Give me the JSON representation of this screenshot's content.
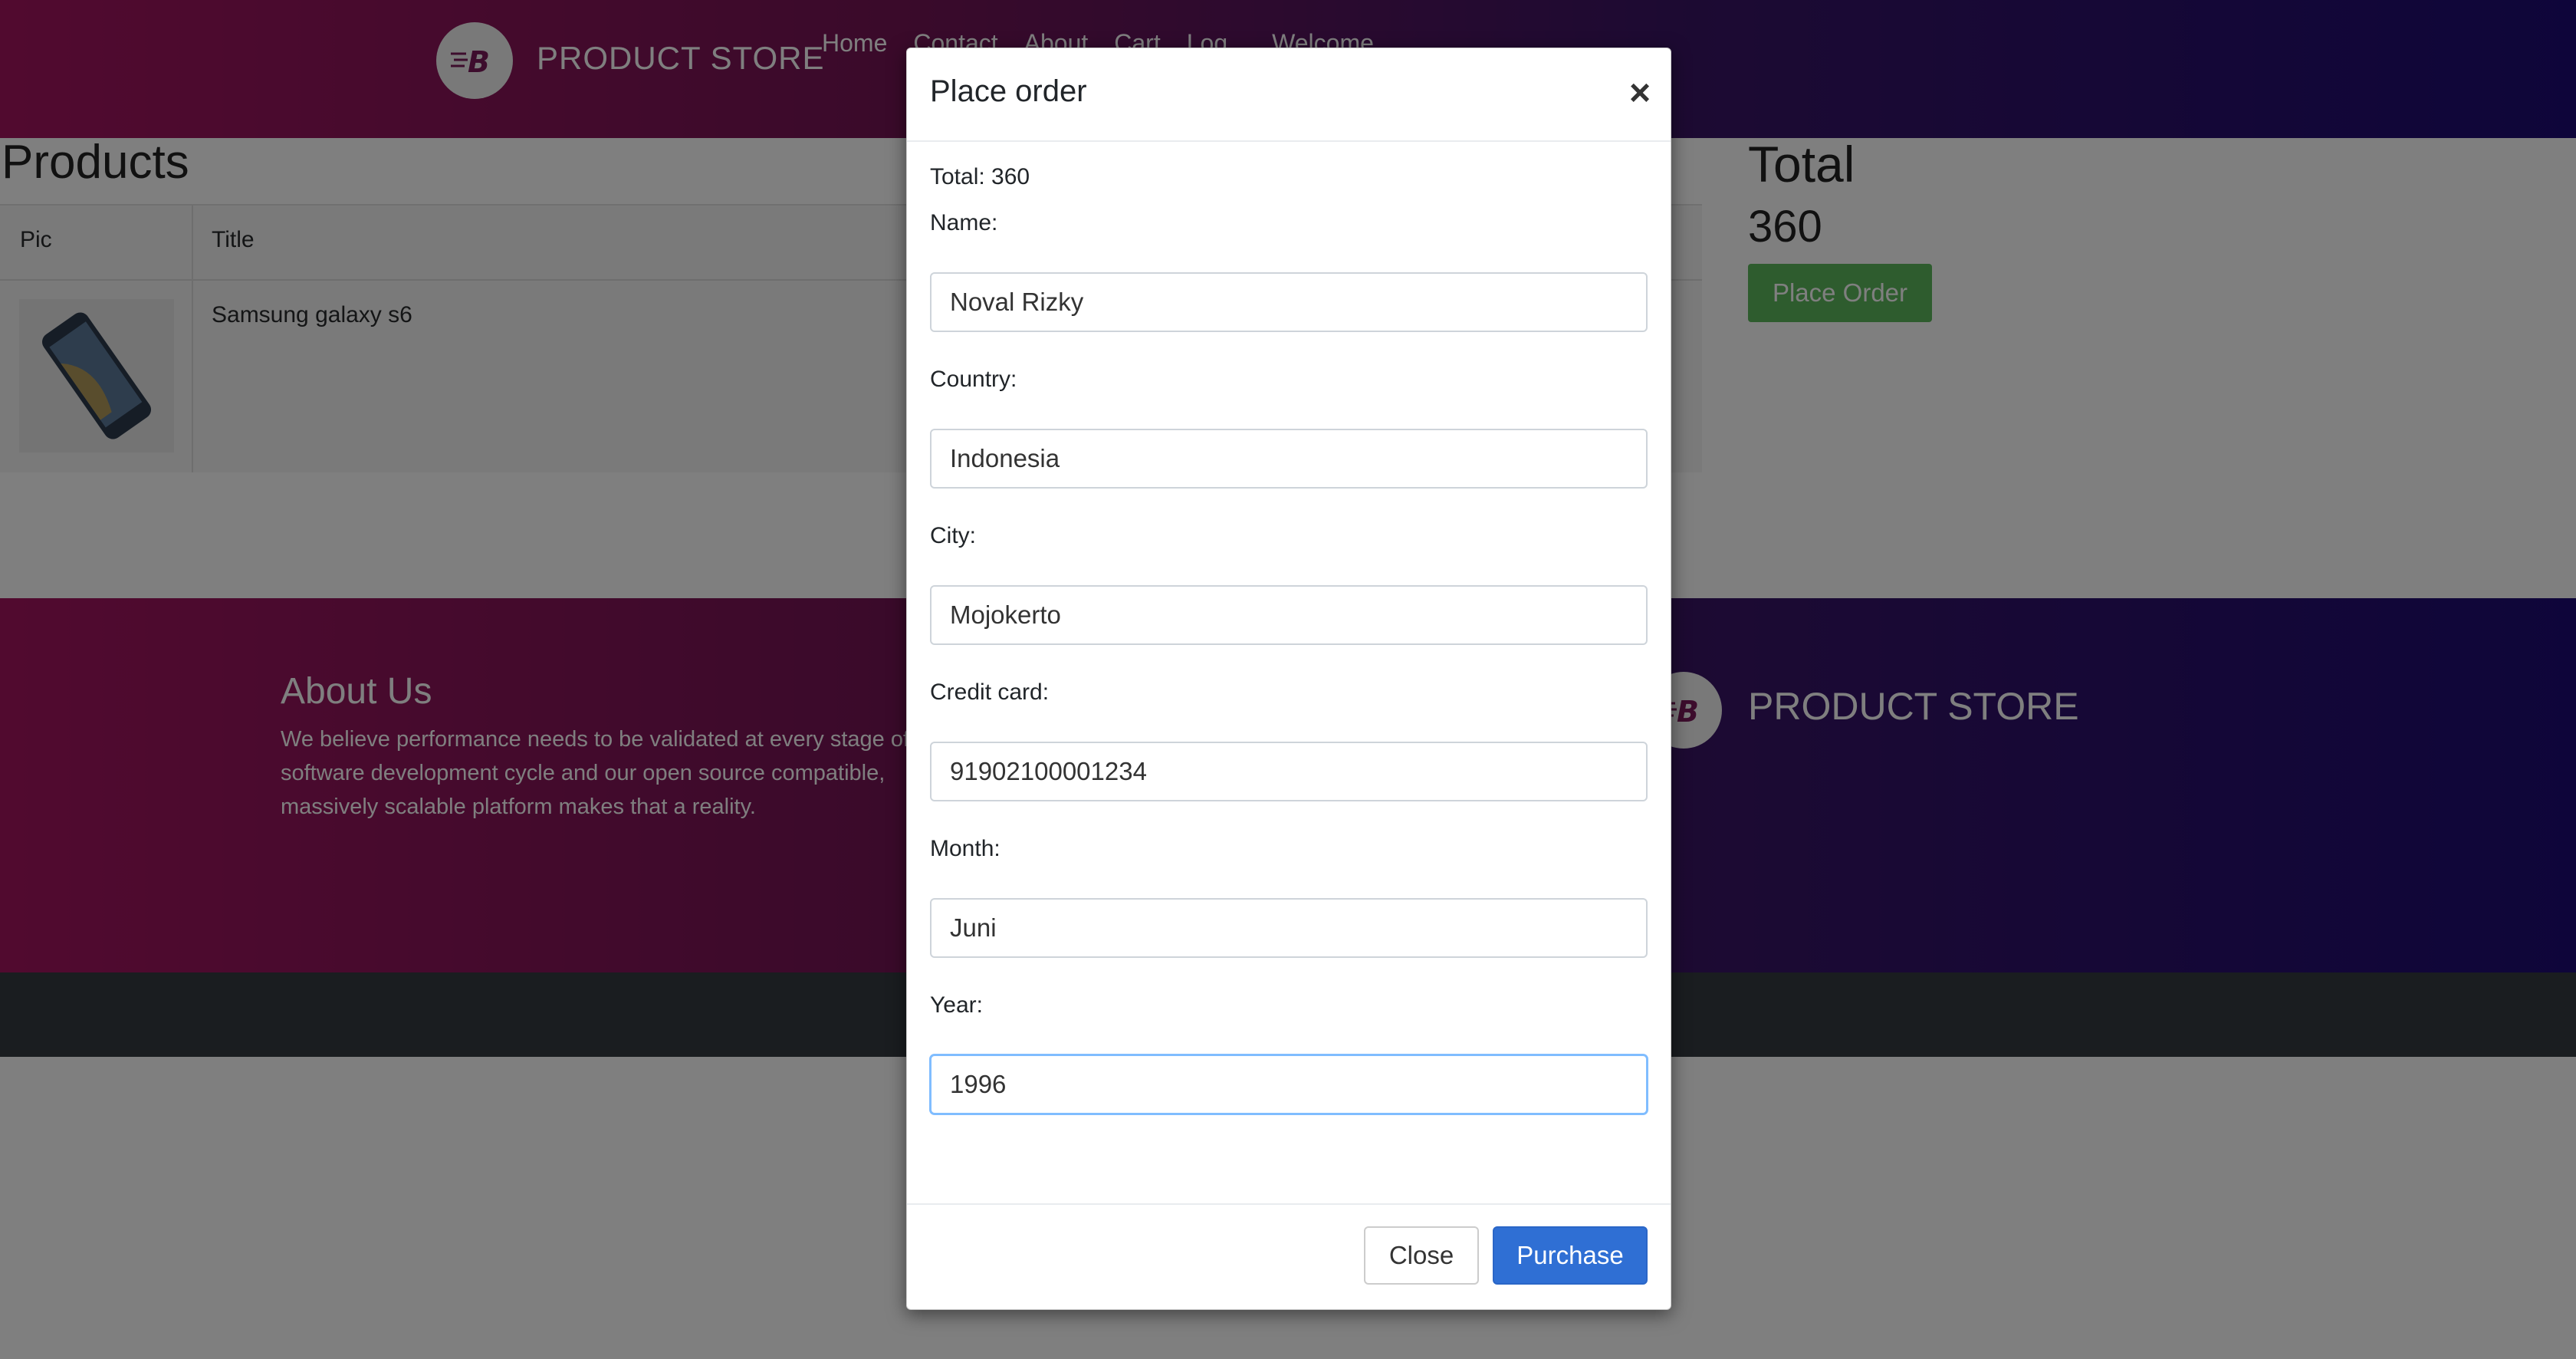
{
  "navbar": {
    "brand": "PRODUCT STORE",
    "links": [
      "Home",
      "Contact",
      "About",
      "Cart",
      "Log",
      "Welcome"
    ]
  },
  "products": {
    "heading": "Products",
    "columns": [
      "Pic",
      "Title"
    ],
    "rows": [
      {
        "title": "Samsung galaxy s6"
      }
    ]
  },
  "summary": {
    "heading": "Total",
    "value": "360",
    "place_order_label": "Place Order"
  },
  "footer": {
    "about_title": "About Us",
    "about_text": "We believe performance needs to be validated at every stage of the software development cycle and our open source compatible, massively scalable platform makes that a reality.",
    "brand": "PRODUCT STORE"
  },
  "modal": {
    "title": "Place order",
    "close_symbol": "×",
    "total_text": "Total: 360",
    "fields": {
      "name": {
        "label": "Name:",
        "value": "Noval Rizky"
      },
      "country": {
        "label": "Country:",
        "value": "Indonesia"
      },
      "city": {
        "label": "City:",
        "value": "Mojokerto"
      },
      "card": {
        "label": "Credit card:",
        "value": "91902100001234"
      },
      "month": {
        "label": "Month:",
        "value": "Juni"
      },
      "year": {
        "label": "Year:",
        "value": "1996"
      }
    },
    "close_label": "Close",
    "purchase_label": "Purchase"
  },
  "colors": {
    "primary": "#2f6fd4",
    "success": "#5cb85c",
    "nav_gradient_start": "#a3155f",
    "nav_gradient_end": "#1d0b74"
  }
}
